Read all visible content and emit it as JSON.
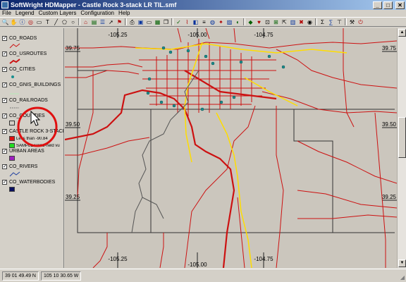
{
  "window": {
    "title": "SoftWright HDMapper - Castle Rock 3-stack LR TIL.smf",
    "minimize": "_",
    "maximize": "□",
    "close": "✕"
  },
  "menu": [
    "File",
    "Legend",
    "Custom Layers",
    "Configuration",
    "Help"
  ],
  "toolbar": {
    "icons": [
      "zoom-icon",
      "pan-icon",
      "info-icon",
      "measure-icon",
      "select-icon",
      "text-icon",
      "line-icon",
      "polygon-icon",
      "circle-icon",
      "home-icon",
      "print-icon",
      "save-icon",
      "open-icon",
      "layers-icon",
      "legend-icon",
      "color-icon",
      "image-icon",
      "grid-icon",
      "globe-icon",
      "satellite-icon",
      "settings-icon",
      "exit-icon"
    ]
  },
  "legend": {
    "layers": [
      {
        "name": "CO_ROADS",
        "checked": true
      },
      {
        "name": "CO_USROUTES",
        "checked": true
      },
      {
        "name": "CO_CITIES",
        "checked": true
      },
      {
        "name": "CO_GNIS_BUILDINGS",
        "checked": true
      },
      {
        "name": "CO_RAILROADS",
        "checked": true
      },
      {
        "name": "CO_COUNTIES",
        "checked": true
      },
      {
        "name": "CASTLE ROCK 3-STACK LI",
        "checked": true,
        "items": [
          "Less than -90.84",
          "SAMPLE Hand-held vu"
        ]
      },
      {
        "name": "URBAN AREAS",
        "checked": true
      },
      {
        "name": "CO_RIVERS",
        "checked": true
      },
      {
        "name": "CO_WATERBODIES",
        "checked": true
      }
    ]
  },
  "map": {
    "top_lon_labels": [
      "-105.25",
      "-105.00",
      "-104.75"
    ],
    "bottom_lon_labels": [
      "-105.25",
      "-105.00",
      "-104.75"
    ],
    "left_lat_labels": [
      "39.75",
      "39.50",
      "39.25"
    ],
    "right_lat_labels": [
      "39.75",
      "39.50",
      "39.25"
    ],
    "colors": {
      "background": "#cbc6bd",
      "roads": "#cc1111",
      "us_routes": "#ffdd00",
      "cities": "#1a8f8f",
      "rivers": "#666666",
      "counties": "#333333",
      "annotation_circle": "#e01010"
    }
  },
  "status": {
    "latitude": "39 01 49.49 N",
    "longitude": "105 10 30.65 W"
  }
}
